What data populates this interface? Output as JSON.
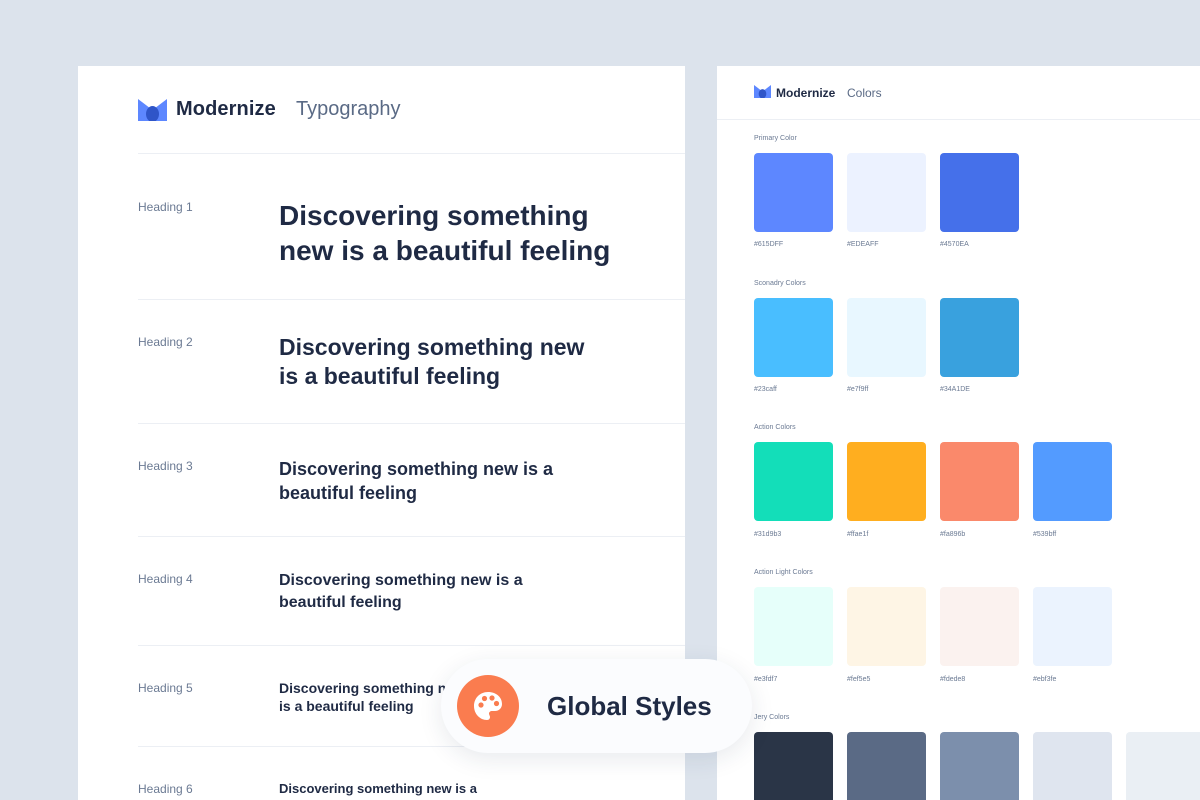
{
  "typography_panel": {
    "brand": "Modernize",
    "page_title": "Typography",
    "headings": [
      {
        "label": "Heading 1",
        "sample": "Discovering something new is a beautiful feeling"
      },
      {
        "label": "Heading 2",
        "sample": "Discovering something new is a beautiful feeling"
      },
      {
        "label": "Heading 3",
        "sample": "Discovering something new is a beautiful feeling"
      },
      {
        "label": "Heading 4",
        "sample": "Discovering something new is a beautiful feeling"
      },
      {
        "label": "Heading 5",
        "sample": "Discovering something new is a beautiful feeling"
      },
      {
        "label": "Heading 6",
        "sample": "Discovering something new is a beautiful feeling"
      }
    ]
  },
  "colors_panel": {
    "brand": "Modernize",
    "page_title": "Colors",
    "groups": [
      {
        "label": "Primary Color",
        "swatches": [
          {
            "hex": "#615DFF",
            "color": "#5d87ff"
          },
          {
            "hex": "#EDEAFF",
            "color": "#ecf2ff"
          },
          {
            "hex": "#4570EA",
            "color": "#4570ea"
          }
        ]
      },
      {
        "label": "Sconadry Colors",
        "swatches": [
          {
            "hex": "#23caff",
            "color": "#49beff"
          },
          {
            "hex": "#e7f9ff",
            "color": "#e8f7ff"
          },
          {
            "hex": "#34A1DE",
            "color": "#39a1de"
          }
        ]
      },
      {
        "label": "Action Colors",
        "swatches": [
          {
            "hex": "#31d9b3",
            "color": "#13deb9"
          },
          {
            "hex": "#ffae1f",
            "color": "#ffae1f"
          },
          {
            "hex": "#fa896b",
            "color": "#fa896b"
          },
          {
            "hex": "#539bff",
            "color": "#539bff"
          }
        ]
      },
      {
        "label": "Action Light Colors",
        "swatches": [
          {
            "hex": "#e3fdf7",
            "color": "#e6fffa"
          },
          {
            "hex": "#fef5e5",
            "color": "#fef5e5"
          },
          {
            "hex": "#fdede8",
            "color": "#fbf2ef"
          },
          {
            "hex": "#ebf3fe",
            "color": "#ebf3fe"
          }
        ]
      },
      {
        "label": "Jery Colors",
        "swatches": [
          {
            "hex": "",
            "color": "#2a3547"
          },
          {
            "hex": "",
            "color": "#5a6a85"
          },
          {
            "hex": "",
            "color": "#7c8fac"
          },
          {
            "hex": "",
            "color": "#dfe5ef"
          },
          {
            "hex": "",
            "color": "#eaeff4"
          }
        ]
      }
    ]
  },
  "global_pill": {
    "title": "Global Styles",
    "icon": "palette-icon"
  },
  "theme": {
    "brand_blue": "#5d87ff",
    "brand_dark_blue": "#3a5fd8",
    "text_dark": "#1f2a44",
    "badge_orange": "#fa7c4f"
  }
}
